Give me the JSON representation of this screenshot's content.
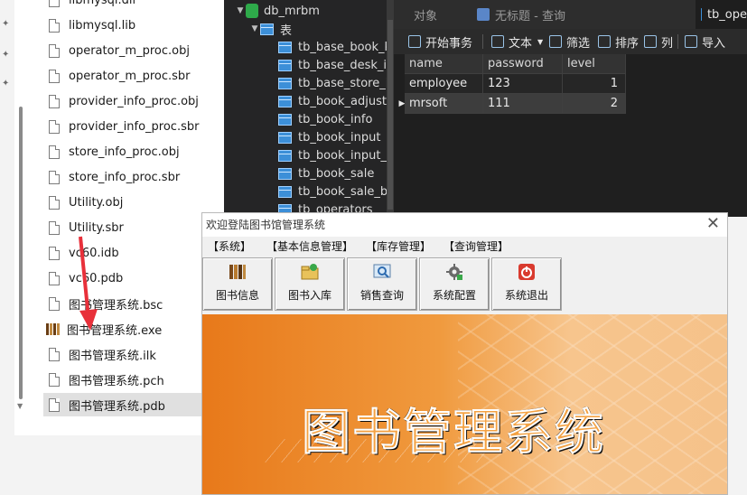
{
  "explorer": {
    "files": [
      {
        "name": "libmysql.dll",
        "type": "file"
      },
      {
        "name": "libmysql.lib",
        "type": "file"
      },
      {
        "name": "operator_m_proc.obj",
        "type": "file"
      },
      {
        "name": "operator_m_proc.sbr",
        "type": "file"
      },
      {
        "name": "provider_info_proc.obj",
        "type": "file"
      },
      {
        "name": "provider_info_proc.sbr",
        "type": "file"
      },
      {
        "name": "store_info_proc.obj",
        "type": "file"
      },
      {
        "name": "store_info_proc.sbr",
        "type": "file"
      },
      {
        "name": "Utility.obj",
        "type": "file"
      },
      {
        "name": "Utility.sbr",
        "type": "file"
      },
      {
        "name": "vc60.idb",
        "type": "file"
      },
      {
        "name": "vc60.pdb",
        "type": "file"
      },
      {
        "name": "图书管理系统.bsc",
        "type": "file"
      },
      {
        "name": "图书管理系统.exe",
        "type": "exe"
      },
      {
        "name": "图书管理系统.ilk",
        "type": "file"
      },
      {
        "name": "图书管理系统.pch",
        "type": "file"
      },
      {
        "name": "图书管理系统.pdb",
        "type": "file",
        "selected": true
      }
    ]
  },
  "navicat": {
    "database": "db_mrbm",
    "tables_node": "表",
    "tables": [
      "tb_base_book_kind",
      "tb_base_desk_info",
      "tb_base_store_info",
      "tb_book_adjust",
      "tb_book_info",
      "tb_book_input",
      "tb_book_input_back",
      "tb_book_sale",
      "tb_book_sale_back",
      "tb_operators"
    ],
    "tabs": [
      {
        "label": "对象",
        "active": false
      },
      {
        "label": "无标题 - 查询",
        "active": false
      },
      {
        "label": "tb_ope",
        "active": true
      }
    ],
    "toolbar": {
      "begin_tx": "开始事务",
      "text": "文本",
      "filter": "筛选",
      "sort": "排序",
      "columns": "列",
      "import": "导入"
    },
    "grid": {
      "columns": [
        "name",
        "password",
        "level"
      ],
      "rows": [
        [
          "employee",
          "123",
          "1"
        ],
        [
          "mrsoft",
          "111",
          "2"
        ]
      ],
      "selected_row": 1
    }
  },
  "app": {
    "title": "欢迎登陆图书馆管理系统",
    "close": "✕",
    "menu": [
      "【系统】",
      "【基本信息管理】",
      "【库存管理】",
      "【查询管理】"
    ],
    "buttons": [
      "图书信息",
      "图书入库",
      "销售查询",
      "系统配置",
      "系统退出"
    ],
    "banner_title": "图书管理系统"
  }
}
